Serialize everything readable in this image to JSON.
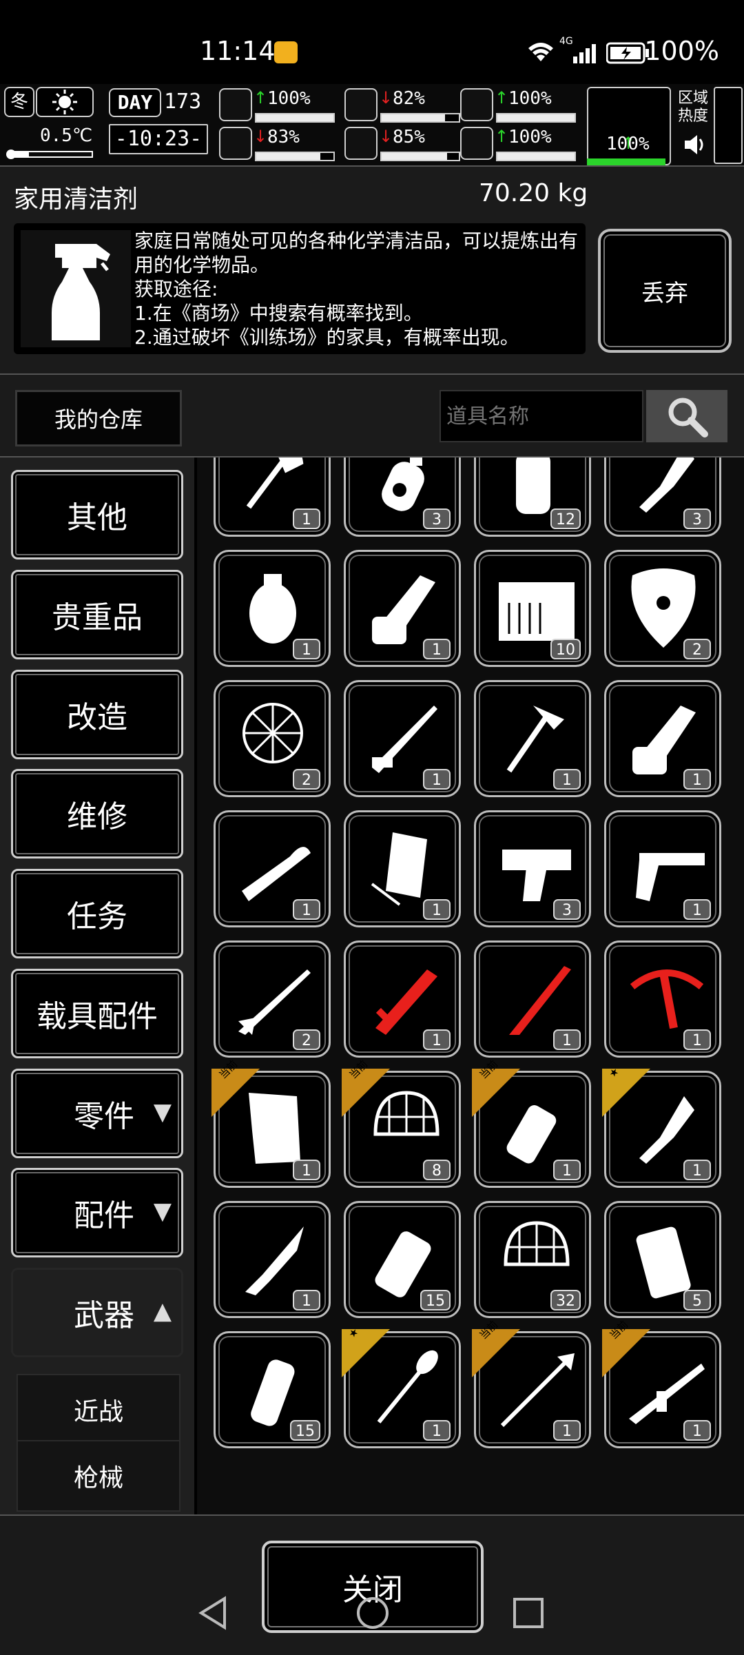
{
  "status_bar": {
    "time": "11:14",
    "network": "4G",
    "battery": "100%"
  },
  "hud": {
    "season": "冬",
    "temperature": "0.5℃",
    "day_label": "DAY",
    "day": "173",
    "clock": "-10:23-",
    "zone_heat_label": "区域\n热度",
    "stats": [
      {
        "icon": "medkit-icon",
        "trend": "up",
        "value": "100%",
        "level": 1.0
      },
      {
        "icon": "stomach-icon",
        "trend": "down",
        "value": "82%",
        "level": 0.82
      },
      {
        "icon": "armor-icon",
        "trend": "up",
        "value": "100%",
        "level": 1.0
      },
      {
        "icon": "brain-icon",
        "trend": "down",
        "value": "83%",
        "level": 0.83
      },
      {
        "icon": "water-drop-icon",
        "trend": "down",
        "value": "85%",
        "level": 0.85
      },
      {
        "icon": "heart-icon",
        "trend": "up",
        "value": "100%",
        "level": 1.0
      },
      {
        "icon": "boot-icon",
        "trend": "up",
        "value": "100%",
        "level": 1.0
      }
    ]
  },
  "item": {
    "name": "家用清洁剂",
    "weight": "70.20 kg",
    "icon": "spray-bottle-icon",
    "description": "家庭日常随处可见的各种化学清洁品，可以提炼出有用的化学物品。\n获取途径:\n1.在《商场》中搜索有概率找到。\n2.通过破坏《训练场》的家具，有概率出现。",
    "discard_label": "丢弃"
  },
  "storage": {
    "title": "我的仓库",
    "search_placeholder": "道具名称"
  },
  "categories": [
    {
      "label": "其他"
    },
    {
      "label": "贵重品"
    },
    {
      "label": "改造"
    },
    {
      "label": "维修"
    },
    {
      "label": "任务"
    },
    {
      "label": "载具配件"
    },
    {
      "label": "零件",
      "arrow": "🡇"
    },
    {
      "label": "配件",
      "arrow": "🡇"
    },
    {
      "label": "武器",
      "arrow": "🡅"
    }
  ],
  "subcategories": [
    {
      "label": "近战"
    },
    {
      "label": "枪械"
    }
  ],
  "items": [
    {
      "icon": "axe-icon",
      "count": "1",
      "color": "#ffffff"
    },
    {
      "icon": "radioactive-canister-icon",
      "count": "3",
      "color": "#ffffff"
    },
    {
      "icon": "smoke-grenade-icon",
      "count": "12",
      "color": "#ffffff"
    },
    {
      "icon": "hatchet-knife-icon",
      "count": "3",
      "color": "#ffffff"
    },
    {
      "icon": "grenade-icon",
      "count": "1",
      "color": "#ffffff"
    },
    {
      "icon": "chainsaw-icon",
      "count": "1",
      "color": "#ffffff"
    },
    {
      "icon": "ammo-crate-icon",
      "count": "10",
      "color": "#ffffff"
    },
    {
      "icon": "shield-icon",
      "count": "2",
      "color": "#ffffff"
    },
    {
      "icon": "net-trap-icon",
      "count": "2",
      "color": "#ffffff"
    },
    {
      "icon": "rifle-icon",
      "count": "1",
      "color": "#ffffff"
    },
    {
      "icon": "pickaxe-icon",
      "count": "1",
      "color": "#ffffff"
    },
    {
      "icon": "chainsaw-icon",
      "count": "1",
      "color": "#ffffff"
    },
    {
      "icon": "crossbow-pistol-icon",
      "count": "1",
      "color": "#ffffff"
    },
    {
      "icon": "folding-chair-icon",
      "count": "1",
      "color": "#ffffff"
    },
    {
      "icon": "desert-eagle-icon",
      "count": "3",
      "color": "#ffffff"
    },
    {
      "icon": "revolver-icon",
      "count": "1",
      "color": "#ffffff"
    },
    {
      "icon": "shotgun-icon",
      "count": "2",
      "color": "#ffffff"
    },
    {
      "icon": "red-sword-icon",
      "count": "1",
      "color": "#e8201c"
    },
    {
      "icon": "red-machete-icon",
      "count": "1",
      "color": "#e8201c"
    },
    {
      "icon": "red-crossbow-icon",
      "count": "1",
      "color": "#e8201c"
    },
    {
      "icon": "torn-paper-icon",
      "count": "1",
      "color": "#ffffff",
      "badge": "当前"
    },
    {
      "icon": "helmet-net-icon",
      "count": "8",
      "color": "#ffffff",
      "badge": "当前"
    },
    {
      "icon": "frag-grenade-icon",
      "count": "1",
      "color": "#ffffff",
      "badge": "当前"
    },
    {
      "icon": "hatchet-knife-icon",
      "count": "1",
      "color": "#ffffff",
      "badge": "★"
    },
    {
      "icon": "combat-knife-icon",
      "count": "1",
      "color": "#ffffff"
    },
    {
      "icon": "flashlight-icon",
      "count": "15",
      "color": "#ffffff"
    },
    {
      "icon": "helmet-net-icon",
      "count": "32",
      "color": "#ffffff"
    },
    {
      "icon": "fire-bag-icon",
      "count": "5",
      "color": "#ffffff"
    },
    {
      "icon": "spiked-grenade-icon",
      "count": "15",
      "color": "#ffffff"
    },
    {
      "icon": "shovel-icon",
      "count": "1",
      "color": "#ffffff",
      "badge": "★"
    },
    {
      "icon": "spear-icon",
      "count": "1",
      "color": "#ffffff",
      "badge": "当前"
    },
    {
      "icon": "assault-rifle-icon",
      "count": "1",
      "color": "#ffffff",
      "badge": "当前"
    }
  ],
  "close_label": "关闭",
  "nav": {
    "back": "back-icon",
    "home": "home-icon",
    "recents": "recents-icon"
  }
}
